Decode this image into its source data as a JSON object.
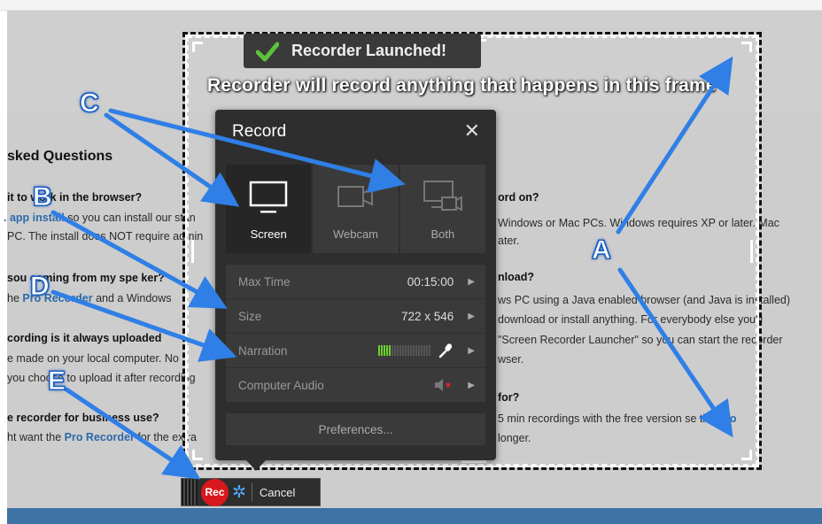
{
  "background": {
    "heading": "sked Questions",
    "faq_lines": [
      {
        "text": " it to ",
        "bold": "",
        "id": "l1"
      },
      {
        "text": "",
        "id": "l2"
      }
    ],
    "left_q1": "it to work in the browser?",
    "left_a1_link": ". app install",
    "left_a1_rest": " so you can install our stan",
    "left_a1_line2": "PC. The install does NOT require admin",
    "left_q2": " sou  coming from my spe ker?",
    "left_a2_pre": "he ",
    "left_a2_link": "Pro Recorder",
    "left_a2_rest": " and a Windows",
    "left_q3": "cording is it always uploaded",
    "left_a3": "e made on your local computer. No",
    "left_a3b": "you choose to upload it after recording",
    "left_q4": "e recorder for business use?",
    "left_a4_pre": "ht want the ",
    "left_a4_link": "Pro Recorder",
    "left_a4_rest": " for the extra",
    "right_q1": "ord on?",
    "right_a1": " Windows or Mac PCs. Windows requires XP or later. Mac",
    "right_a1b": "ater.",
    "right_q2": "nload?",
    "right_a2": "ws PC using a Java enabled browser (and Java is installed)",
    "right_a2b": " download or install anything. For everybody else you'll",
    "right_a2c": " \"Screen Recorder Launcher\" so you can start the recorder",
    "right_a2d": "wser.",
    "right_q3": "for?",
    "right_a3_pre": "5 min recordings with the free version  se the ",
    "right_a3_link": "Pro",
    "right_a3b": " longer."
  },
  "frame": {
    "message": "Recorder will record anything that happens in this frame"
  },
  "toast": {
    "label": "Recorder Launched!"
  },
  "dialog": {
    "title": "Record",
    "close_glyph": "✕",
    "modes": [
      {
        "label": "Screen",
        "icon": "monitor-icon",
        "active": true
      },
      {
        "label": "Webcam",
        "icon": "webcam-icon",
        "active": false
      },
      {
        "label": "Both",
        "icon": "screen-webcam-icon",
        "active": false
      }
    ],
    "rows": {
      "max_time_label": "Max Time",
      "max_time_value": "00:15:00",
      "size_label": "Size",
      "size_value": "722 x 546",
      "narration_label": "Narration",
      "narration_level": 0.25,
      "computer_audio_label": "Computer Audio"
    },
    "preferences_label": "Preferences..."
  },
  "toolbar": {
    "rec_label": "Rec",
    "cancel_label": "Cancel"
  },
  "annotations": {
    "A": "A",
    "B": "B",
    "C": "C",
    "D": "D",
    "E": "E",
    "color": "#2f7fe6"
  }
}
